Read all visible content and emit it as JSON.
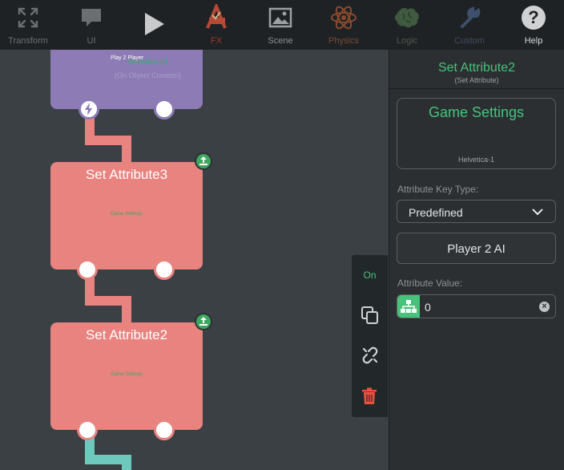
{
  "toolbar": {
    "items": [
      {
        "label": "Transform",
        "icon": "transform-icon",
        "enabled": false
      },
      {
        "label": "UI",
        "icon": "speech-bubble-icon",
        "enabled": false
      },
      {
        "label": "",
        "icon": "play-icon",
        "enabled": true
      },
      {
        "label": "FX",
        "icon": "fx-icon",
        "enabled": false
      },
      {
        "label": "Scene",
        "icon": "image-icon",
        "enabled": true
      },
      {
        "label": "Physics",
        "icon": "atom-icon",
        "enabled": false
      },
      {
        "label": "Logic",
        "icon": "brain-icon",
        "enabled": false
      },
      {
        "label": "Custom",
        "icon": "wrench-icon",
        "enabled": false
      },
      {
        "label": "Help",
        "icon": "help-icon",
        "enabled": true
      }
    ]
  },
  "canvas": {
    "top_node": {
      "caption": "Play 2 Player",
      "line1": "Helvetica-12",
      "line2": "(On Object Creation)"
    },
    "node3": {
      "title": "Set Attribute3",
      "subtitle": "Game Settings"
    },
    "node2": {
      "title": "Set Attribute2",
      "subtitle": "Game Settings"
    }
  },
  "floating_toolbar": {
    "on_label": "On"
  },
  "inspector": {
    "title": "Set Attribute2",
    "subtitle": "(Set Attribute)",
    "preview": {
      "title": "Game Settings",
      "font": "Helvetica-1"
    },
    "key_type_label": "Attribute Key Type:",
    "key_type_value": "Predefined",
    "key_button": "Player 2 AI",
    "value_label": "Attribute Value:",
    "value": "0"
  },
  "colors": {
    "accent_green": "#47c27a",
    "node_red": "#e8837f",
    "node_purple": "#8c7bb5",
    "wire_red": "#e8837f",
    "wire_teal": "#6ec9bd",
    "delete_red": "#e8533e"
  }
}
